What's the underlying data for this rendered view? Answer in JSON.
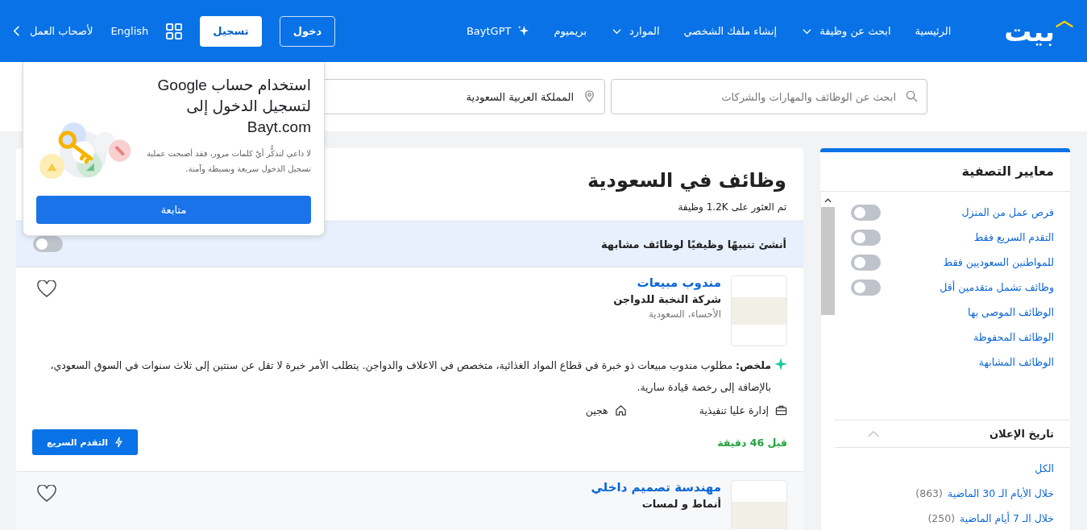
{
  "nav": {
    "logo": "بيت",
    "items": [
      {
        "label": "الرئيسية",
        "kind": "link"
      },
      {
        "label": "ابحث عن وظيفة",
        "kind": "menu"
      },
      {
        "label": "إنشاء ملفك الشخصي",
        "kind": "link"
      },
      {
        "label": "الموارد",
        "kind": "menu"
      },
      {
        "label": "بريميوم",
        "kind": "link"
      },
      {
        "label": "BaytGPT",
        "kind": "ai"
      }
    ],
    "login": "دخول",
    "register": "تسجيل",
    "language": "English",
    "employers": "لأصحاب العمل"
  },
  "search": {
    "placeholder": "ابحث عن الوظائف والمهارات والشركات",
    "location": "المملكة العربية السعودية"
  },
  "google_prompt": {
    "title": "استخدام حساب Google لتسجيل الدخول إلى Bayt.com",
    "body": "لا داعي لتذكُّر أيّ كلمات مرور، فقد أصبحت عملية تسجيل الدخول سريعة وبسيطة وآمنة.",
    "button": "متابعة"
  },
  "filters": {
    "title": "معايير التصفية",
    "toggles": [
      {
        "label": "فرص عمل من المنزل",
        "on": false
      },
      {
        "label": "التقدم السريع فقط",
        "on": false
      },
      {
        "label": "للمواطنين السعوديين فقط",
        "on": false
      },
      {
        "label": "وظائف تشمل متقدمين أقل",
        "on": false
      }
    ],
    "links": [
      "الوظائف الموصى بها",
      "الوظائف المحفوظة",
      "الوظائف المشابهة"
    ],
    "date_section": {
      "title": "تاريخ الإعلان",
      "expanded": true,
      "options": [
        {
          "label": "الكل"
        },
        {
          "label": "خلال الأيام الـ 30 الماضية",
          "count": "(863)"
        },
        {
          "label": "خلال الـ 7 أيام الماضية",
          "count": "(250)"
        }
      ]
    }
  },
  "results": {
    "title": "وظائف في السعودية",
    "count": "تم العثور على 1.2K وظيفة",
    "alert": {
      "label": "أنشئ تنبيهًا وظيفيًا لوظائف مشابهة",
      "on": false
    },
    "jobs": [
      {
        "title": "مندوب مبيعات",
        "company": "شركة النخبة للدواجن",
        "location": "الأحساء، السعودية",
        "summary": "**ملخص:** مطلوب مندوب مبيعات ذو خبرة في قطاع المواد الغذائية، متخصص في الاعلاف والدواجن. يتطلب الأمر خبرة لا تقل عن سنتين إلى ثلاث سنوات في السوق السعودي، بالإضافة إلى رخصة قيادة سارية.",
        "tags": [
          {
            "kind": "level",
            "text": "إدارة عليا تنفيذية"
          },
          {
            "kind": "workplace",
            "text": "هجين"
          }
        ],
        "posted": "قبل 46 دقيقة",
        "apply": "التقدم السريع",
        "saved": false
      },
      {
        "title": "مهندسة تصميم داخلي",
        "company": "أنماط و لمسات",
        "saved": false
      }
    ]
  }
}
